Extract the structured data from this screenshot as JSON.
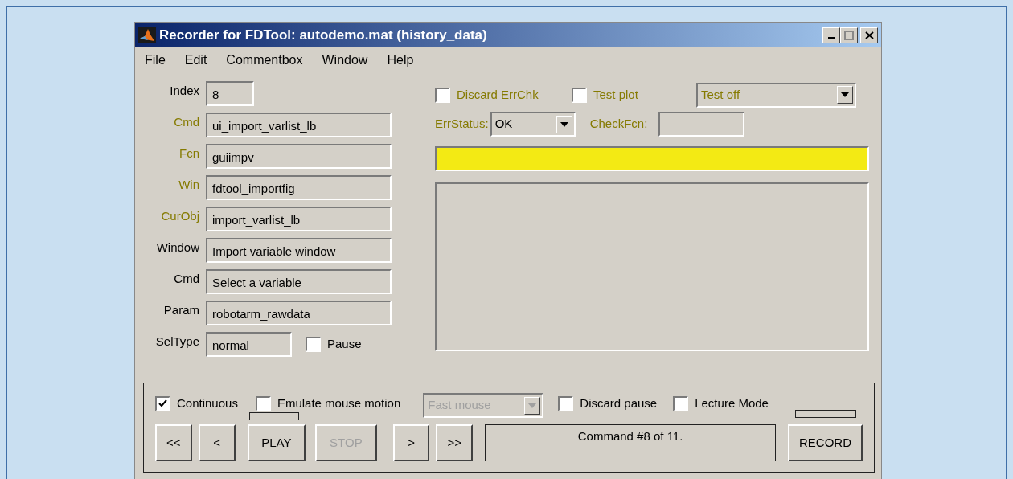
{
  "window": {
    "title": "Recorder for FDTool: autodemo.mat (history_data)"
  },
  "menu": [
    "File",
    "Edit",
    "Commentbox",
    "Window",
    "Help"
  ],
  "fields": [
    {
      "label": "Index",
      "value": "8",
      "color": "#000000",
      "kind": "short"
    },
    {
      "label": "Cmd",
      "value": "ui_import_varlist_lb",
      "color": "#857a00",
      "kind": "long"
    },
    {
      "label": "Fcn",
      "value": "guiimpv",
      "color": "#857a00",
      "kind": "long"
    },
    {
      "label": "Win",
      "value": "fdtool_importfig",
      "color": "#857a00",
      "kind": "long"
    },
    {
      "label": "CurObj",
      "value": "import_varlist_lb",
      "color": "#857a00",
      "kind": "long"
    },
    {
      "label": "Window",
      "value": "Import variable window",
      "color": "#000000",
      "kind": "long"
    },
    {
      "label": "Cmd",
      "value": "Select a variable",
      "color": "#000000",
      "kind": "long"
    },
    {
      "label": "Param",
      "value": "robotarm_rawdata",
      "color": "#000000",
      "kind": "long"
    },
    {
      "label": "SelType",
      "value": "normal",
      "color": "#000000",
      "kind": "medium"
    }
  ],
  "pause": {
    "label": "Pause",
    "checked": false
  },
  "options": [
    {
      "label": "Discard ErrChk",
      "checked": false
    },
    {
      "label": "Test plot",
      "checked": false
    }
  ],
  "test_mode": {
    "value": "Test off"
  },
  "err_status": {
    "label": "ErrStatus:",
    "value": "OK"
  },
  "check_fcn": {
    "label": "CheckFcn:"
  },
  "playback_options": [
    {
      "label": "Continuous",
      "checked": true
    },
    {
      "label": "Emulate mouse motion",
      "checked": false
    }
  ],
  "mouse_speed": {
    "value": "Fast mouse",
    "disabled": true
  },
  "more_options": [
    {
      "label": "Discard pause",
      "checked": false
    },
    {
      "label": "Lecture Mode",
      "checked": false
    }
  ],
  "buttons": [
    {
      "label": "<<",
      "disabled": false
    },
    {
      "label": "<",
      "disabled": false
    },
    {
      "label": "PLAY",
      "disabled": false
    },
    {
      "label": "STOP",
      "disabled": true
    },
    {
      "label": ">",
      "disabled": false
    },
    {
      "label": ">>",
      "disabled": false
    }
  ],
  "message": "Command #8 of 11.",
  "record": {
    "label": "RECORD"
  }
}
